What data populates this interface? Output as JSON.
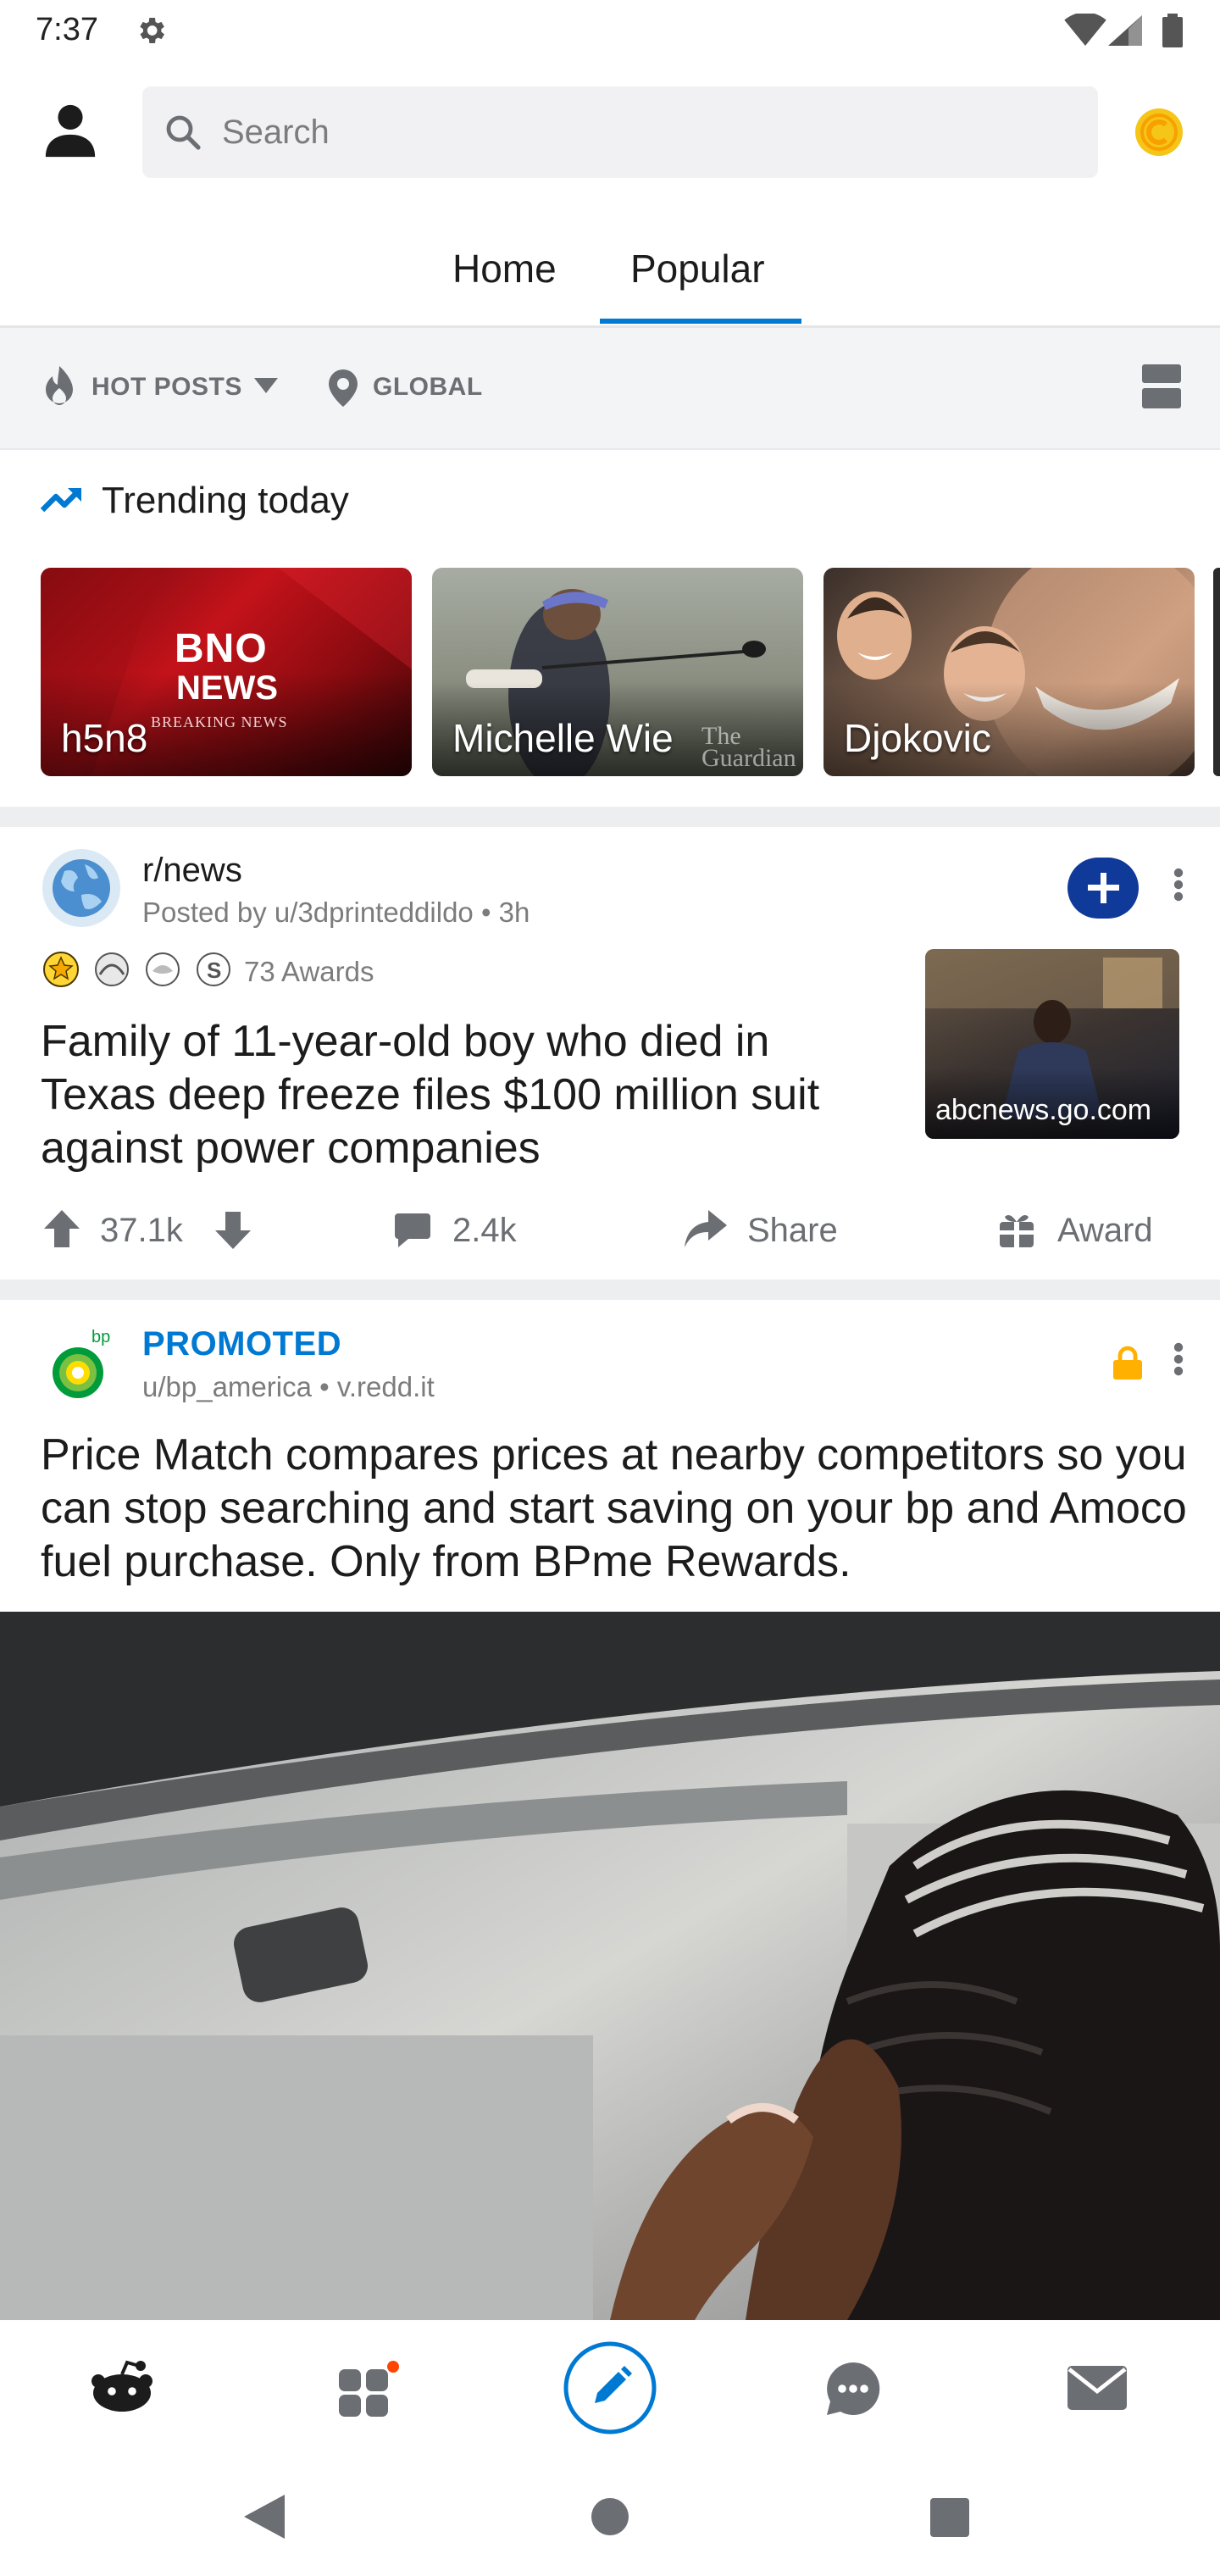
{
  "status_bar": {
    "time": "7:37",
    "icons": [
      "gear-icon",
      "wifi-icon",
      "cell-signal-icon",
      "battery-icon"
    ]
  },
  "header": {
    "search_placeholder": "Search",
    "icons": [
      "profile-icon",
      "search-icon",
      "coins-icon"
    ]
  },
  "tabs": [
    {
      "label": "Home",
      "active": false
    },
    {
      "label": "Popular",
      "active": true
    }
  ],
  "filter_bar": {
    "sort_label": "HOT POSTS",
    "location_label": "GLOBAL",
    "icons": [
      "flame-icon",
      "caret-down-icon",
      "location-pin-icon",
      "card-view-icon"
    ]
  },
  "trending": {
    "title": "Trending today",
    "icon": "trending-up-icon",
    "cards": [
      {
        "label": "h5n8",
        "logo_line1": "BNO",
        "logo_line2": "NEWS",
        "logo_tag": "BREAKING NEWS"
      },
      {
        "label": "Michelle Wie",
        "watermark": "The Guardian"
      },
      {
        "label": "Djokovic"
      }
    ]
  },
  "post": {
    "subreddit": "r/news",
    "meta": "Posted by u/3dprintedding·",
    "meta_full": "Posted by u/3dprinteddildo • 3h",
    "awards": "73 Awards",
    "title": "Family of 11-year-old boy who died in Texas deep freeze files $100 million suit against power companies",
    "thumbnail_domain": "abcnews.go.com",
    "upvotes": "37.1k",
    "comments": "2.4k",
    "share": "Share",
    "award": "Award",
    "icons": [
      "globe-icon",
      "join-plus-icon",
      "more-vertical-icon",
      "upvote-icon",
      "downvote-icon",
      "comment-icon",
      "share-icon",
      "award-icon"
    ]
  },
  "promo": {
    "label": "PROMOTED",
    "meta": "u/bp_america • v.redd.it",
    "title": "Price Match compares prices at nearby competitors so you can stop searching and start saving on your bp and Amoco fuel purchase. Only from BPme Rewards.",
    "logo_text": "bp",
    "icons": [
      "bp-logo-icon",
      "lock-icon",
      "more-vertical-icon"
    ]
  },
  "bottom_nav": {
    "icons": [
      "reddit-home-icon",
      "communities-icon",
      "create-post-icon",
      "chat-icon",
      "inbox-icon"
    ],
    "notification_color": "#ff4500"
  },
  "system_nav": {
    "icons": [
      "back-icon",
      "home-circle-icon",
      "recents-icon"
    ]
  },
  "colors": {
    "accent": "#0079d3",
    "promoted": "#0079d3",
    "lock": "#ffb000",
    "coin": "#f5c518"
  }
}
